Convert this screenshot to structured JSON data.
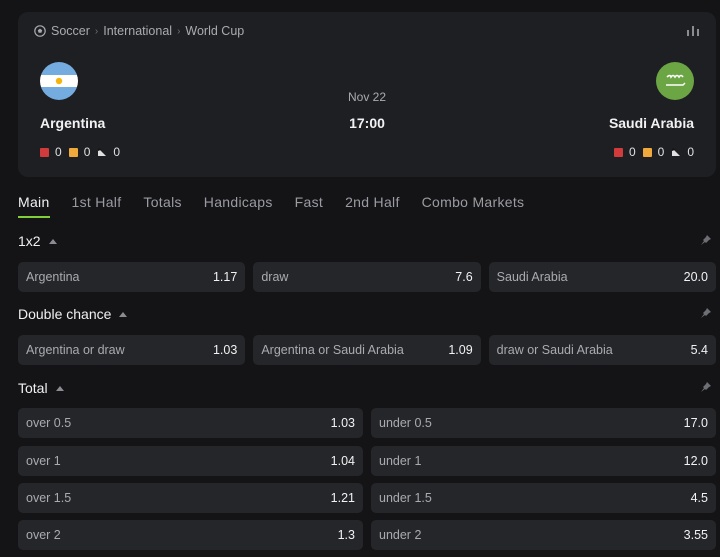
{
  "breadcrumb": {
    "sport": "Soccer",
    "category": "International",
    "tournament": "World Cup"
  },
  "match": {
    "date": "Nov 22",
    "time": "17:00",
    "home": {
      "name": "Argentina",
      "red_cards": "0",
      "yellow_cards": "0",
      "corners": "0"
    },
    "away": {
      "name": "Saudi Arabia",
      "red_cards": "0",
      "yellow_cards": "0",
      "corners": "0"
    }
  },
  "tabs": [
    "Main",
    "1st Half",
    "Totals",
    "Handicaps",
    "Fast",
    "2nd Half",
    "Combo Markets"
  ],
  "markets": {
    "one_x_two": {
      "title": "1x2",
      "outcomes": [
        {
          "label": "Argentina",
          "odd": "1.17"
        },
        {
          "label": "draw",
          "odd": "7.6"
        },
        {
          "label": "Saudi Arabia",
          "odd": "20.0"
        }
      ]
    },
    "double_chance": {
      "title": "Double chance",
      "outcomes": [
        {
          "label": "Argentina or draw",
          "odd": "1.03"
        },
        {
          "label": "Argentina or Saudi Arabia",
          "odd": "1.09"
        },
        {
          "label": "draw or Saudi Arabia",
          "odd": "5.4"
        }
      ]
    },
    "total": {
      "title": "Total",
      "rows": [
        [
          {
            "label": "over 0.5",
            "odd": "1.03"
          },
          {
            "label": "under 0.5",
            "odd": "17.0"
          }
        ],
        [
          {
            "label": "over 1",
            "odd": "1.04"
          },
          {
            "label": "under 1",
            "odd": "12.0"
          }
        ],
        [
          {
            "label": "over 1.5",
            "odd": "1.21"
          },
          {
            "label": "under 1.5",
            "odd": "4.5"
          }
        ],
        [
          {
            "label": "over 2",
            "odd": "1.3"
          },
          {
            "label": "under 2",
            "odd": "3.55"
          }
        ]
      ]
    }
  },
  "colors": {
    "accent": "#7ecf3a",
    "red_card": "#d23b3b",
    "yellow_card": "#f0a93a",
    "panel": "#1e1f22",
    "odd_bg": "#252629"
  },
  "icons": {
    "sport": "soccer-ball-icon",
    "stats": "bar-chart-icon",
    "pin": "pin-icon",
    "collapse": "caret-up-icon",
    "corner": "corner-flag-icon"
  }
}
